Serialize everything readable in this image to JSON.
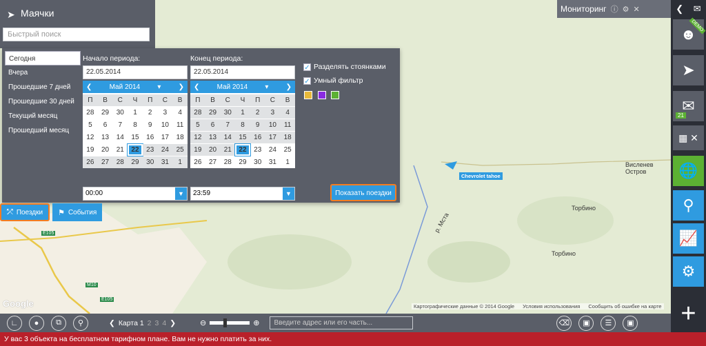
{
  "left_panel": {
    "title": "Маячки",
    "quick_search_placeholder": "Быстрый поиск"
  },
  "period_list": [
    "Сегодня",
    "Вчера",
    "Прошедшие 7 дней",
    "Прошедшие 30 дней",
    "Текущий месяц",
    "Прошедший месяц"
  ],
  "period_start": {
    "label": "Начало периода:",
    "date": "22.05.2014",
    "month": "Май 2014",
    "time": "00:00"
  },
  "period_end": {
    "label": "Конец периода:",
    "date": "22.05.2014",
    "month": "Май 2014",
    "time": "23:59"
  },
  "weekdays": [
    "П",
    "В",
    "С",
    "Ч",
    "П",
    "С",
    "В"
  ],
  "options": {
    "split_stops": "Разделять стоянками",
    "smart_filter": "Умный фильтр"
  },
  "swatch_colors": [
    "#e8b93a",
    "#8a2be2",
    "#5cb133"
  ],
  "show_trips_button": "Показать поездки",
  "tabs": {
    "trips": "Поездки",
    "events": "События"
  },
  "monitoring": {
    "title": "Мониторинг"
  },
  "right_bar": {
    "badge_demo": "DEMO",
    "messages_count": "21"
  },
  "map": {
    "car_label": "Chevrolet tahoe",
    "places": [
      "Висленев Остров",
      "Торбино",
      "Торбино",
      "р. Мста"
    ],
    "roads": [
      "E105",
      "M10",
      "E105"
    ],
    "google": "Google",
    "attribution": [
      "Картографические данные © 2014 Google",
      "Условия использования",
      "Сообщить об ошибке на карте"
    ]
  },
  "bottom_bar": {
    "map_label": "Карта 1",
    "map_pages": [
      "2",
      "3",
      "4"
    ],
    "address_placeholder": "Введите адрес или его часть..."
  },
  "status_message": "У вас 3 объекта на бесплатном тарифном плане. Вам не нужно платить за них."
}
